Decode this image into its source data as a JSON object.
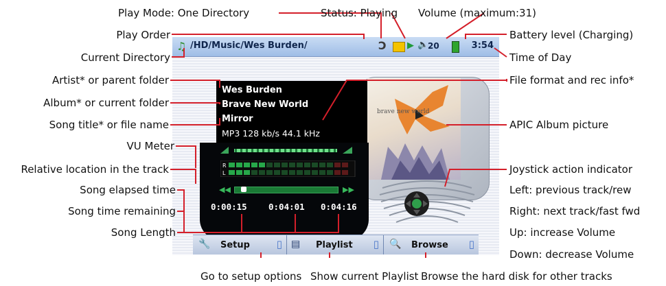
{
  "screen": {
    "path": "/HD/Music/Wes Burden/",
    "volume_value": "20",
    "clock": "3:54",
    "artist": "Wes Burden",
    "album": "Brave New World",
    "song": "Mirror",
    "format": "MP3 128 kb/s 44.1 kHz",
    "elapsed": "0:00:15",
    "remaining": "0:04:01",
    "length": "0:04:16",
    "album_art_text": "brave new world",
    "tabs": [
      {
        "label": "Setup",
        "icon": "wrench-icon"
      },
      {
        "label": "Playlist",
        "icon": "playlist-icon"
      },
      {
        "label": "Browse",
        "icon": "magnifier-icon"
      }
    ]
  },
  "callouts": {
    "play_mode": "Play Mode: One Directory",
    "status": "Status: Playing",
    "volume": "Volume (maximum:31)",
    "play_order": "Play Order",
    "battery": "Battery level (Charging)",
    "current_directory": "Current Directory",
    "time_of_day": "Time of Day",
    "artist": "Artist* or parent folder",
    "file_format": "File format and rec info*",
    "album": "Album* or current folder",
    "song_title": "Song title* or file name",
    "apic": "APIC Album picture",
    "vu_meter": "VU Meter",
    "relative_location": "Relative location in the track",
    "joystick": "Joystick action indicator",
    "left": "Left: previous track/rew",
    "right": "Right: next track/fast fwd",
    "up": "Up: increase Volume",
    "down": "Down: decrease Volume",
    "elapsed": "Song elapsed time",
    "remaining": "Song time remaining",
    "length": "Song Length",
    "setup": "Go to setup options",
    "playlist": "Show current Playlist",
    "browse": "Browse the hard disk for other tracks"
  },
  "colors": {
    "accent_line": "#d41f2a",
    "screen_dark": "#000000",
    "statusbar": "#a8c3ea",
    "vu_green": "#27a84a",
    "vu_red": "#d12b2b"
  },
  "playback_progress": 0.06,
  "progress_display": 0.06
}
